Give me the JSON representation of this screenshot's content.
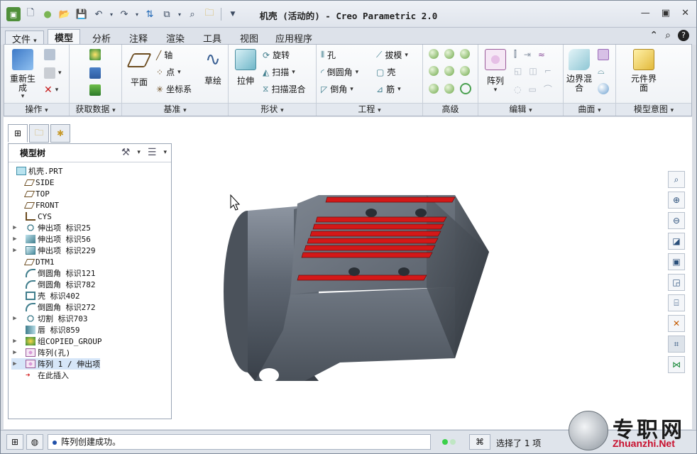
{
  "window": {
    "title": "机壳 (活动的) - Creo Parametric 2.0"
  },
  "tabs": [
    {
      "label": "文件",
      "dropdown": true
    },
    {
      "label": "模型",
      "active": true
    },
    {
      "label": "分析"
    },
    {
      "label": "注释"
    },
    {
      "label": "渲染"
    },
    {
      "label": "工具"
    },
    {
      "label": "视图"
    },
    {
      "label": "应用程序"
    }
  ],
  "ribbon": {
    "groups": {
      "operations": "操作",
      "get_data": "获取数据",
      "datum": "基准",
      "shapes": "形状",
      "engineering": "工程",
      "advanced": "高级",
      "editing": "编辑",
      "surfaces": "曲面",
      "model_intent": "模型意图"
    },
    "regenerate": "重新生成",
    "plane": "平面",
    "axis": "轴",
    "point": "点",
    "csys": "坐标系",
    "sketch": "草绘",
    "extrude": "拉伸",
    "revolve": "旋转",
    "sweep": "扫描",
    "swept_blend": "扫描混合",
    "hole": "孔",
    "round": "倒圆角",
    "chamfer": "倒角",
    "draft": "拔模",
    "shell": "壳",
    "rib": "筋",
    "pattern": "阵列",
    "boundary_blend": "边界混合",
    "component_interface": "元件界面"
  },
  "model_tree": {
    "header": "模型树",
    "items": [
      {
        "text": "机壳.PRT",
        "icon": "part-icon",
        "expand": false,
        "indent": 0
      },
      {
        "text": "SIDE",
        "icon": "datum-plane-icon",
        "expand": false,
        "indent": 1
      },
      {
        "text": "TOP",
        "icon": "datum-plane-icon",
        "expand": false,
        "indent": 1
      },
      {
        "text": "FRONT",
        "icon": "datum-plane-icon",
        "expand": false,
        "indent": 1
      },
      {
        "text": "CYS",
        "icon": "csys-icon",
        "expand": false,
        "indent": 1
      },
      {
        "text": "伸出项 标识25",
        "icon": "revolve-icon",
        "expand": true,
        "indent": 1
      },
      {
        "text": "伸出项 标识56",
        "icon": "sweep-icon",
        "expand": true,
        "indent": 1
      },
      {
        "text": "伸出项 标识229",
        "icon": "extrude-icon",
        "expand": true,
        "indent": 1
      },
      {
        "text": "DTM1",
        "icon": "datum-plane-icon",
        "expand": false,
        "indent": 1
      },
      {
        "text": "倒圆角 标识121",
        "icon": "round-icon",
        "expand": false,
        "indent": 1
      },
      {
        "text": "倒圆角 标识782",
        "icon": "round-icon",
        "expand": false,
        "indent": 1
      },
      {
        "text": "壳 标识402",
        "icon": "shell-icon",
        "expand": false,
        "indent": 1
      },
      {
        "text": "倒圆角 标识272",
        "icon": "round-icon",
        "expand": false,
        "indent": 1
      },
      {
        "text": "切割 标识703",
        "icon": "revolve-icon",
        "expand": true,
        "indent": 1
      },
      {
        "text": "唇 标识859",
        "icon": "lip-icon",
        "expand": false,
        "indent": 1
      },
      {
        "text": "组COPIED_GROUP",
        "icon": "group-icon",
        "expand": true,
        "indent": 1
      },
      {
        "text": "阵列(孔)",
        "icon": "pattern-icon",
        "expand": true,
        "indent": 1
      },
      {
        "text": "阵列 1 / 伸出项",
        "icon": "pattern-icon",
        "expand": true,
        "indent": 1,
        "selected": true
      },
      {
        "text": "在此插入",
        "icon": "insert-arrow-icon",
        "expand": false,
        "indent": 1
      }
    ]
  },
  "status": {
    "message": "阵列创建成功。",
    "selection": "选择了 1 项"
  },
  "watermark": {
    "cn": "专职网",
    "en": "Zhuanzhi.Net"
  }
}
